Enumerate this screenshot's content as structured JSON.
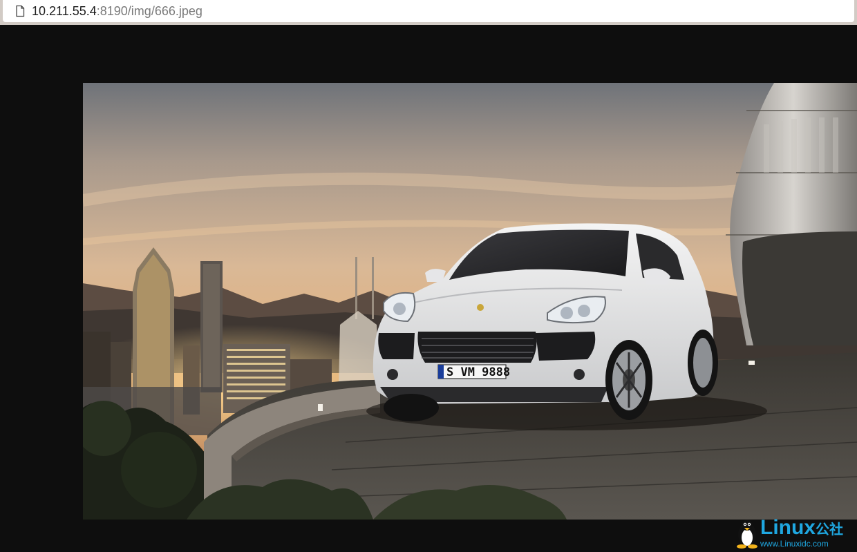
{
  "browser": {
    "page_icon": "document-icon",
    "url_host": "10.211.55.4",
    "url_path": ":8190/img/666.jpeg"
  },
  "image": {
    "license_plate": "S VM 9888",
    "subject": "white suv on rooftop terrace at sunset over city skyline"
  },
  "watermark": {
    "logo_icon": "penguin-icon",
    "brand_latin": "Linux",
    "brand_cjk": "公社",
    "url": "www.Linuxidc.com",
    "color": "#1fa7e0"
  }
}
